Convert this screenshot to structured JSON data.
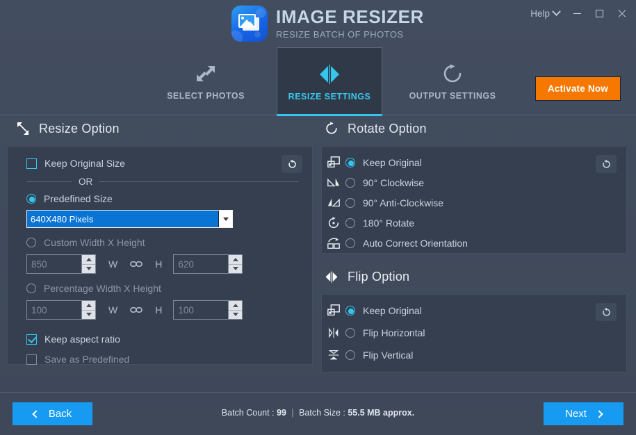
{
  "window": {
    "help_label": "Help",
    "minimize_icon": "minimize-icon",
    "maximize_icon": "maximize-icon",
    "close_icon": "close-icon"
  },
  "brand": {
    "title": "IMAGE RESIZER",
    "subtitle": "RESIZE BATCH OF PHOTOS",
    "logo_icon": "photos-stack-icon"
  },
  "tabs": [
    {
      "label": "SELECT PHOTOS",
      "icon": "expand-arrows-icon",
      "active": false
    },
    {
      "label": "RESIZE SETTINGS",
      "icon": "flip-horizontal-icon",
      "active": true
    },
    {
      "label": "OUTPUT SETTINGS",
      "icon": "rotate-clockwise-icon",
      "active": false
    }
  ],
  "activate": {
    "label": "Activate Now",
    "color": "#f67800"
  },
  "resize": {
    "heading": "Resize Option",
    "heading_icon": "resize-diagonal-icon",
    "reset_icon": "reset-icon",
    "keep_original_size": {
      "label": "Keep Original Size",
      "checked": false
    },
    "or_text": "OR",
    "predefined_size": {
      "label": "Predefined Size",
      "selected": true
    },
    "predefined_dropdown": {
      "value": "640X480 Pixels",
      "icon": "chevron-down-icon"
    },
    "custom_wh": {
      "label": "Custom Width X Height",
      "selected": false
    },
    "custom_width": "850",
    "custom_height": "620",
    "percentage_wh": {
      "label": "Percentage Width X Height",
      "selected": false
    },
    "percentage_width": "100",
    "percentage_height": "100",
    "w_label": "W",
    "h_label": "H",
    "link_icon": "chain-link-icon",
    "keep_aspect_ratio": {
      "label": "Keep aspect ratio",
      "checked": true
    },
    "save_as_predefined": {
      "label": "Save as Predefined",
      "checked": false,
      "disabled": true
    }
  },
  "rotate": {
    "heading": "Rotate Option",
    "heading_icon": "rotate-clockwise-icon",
    "reset_icon": "reset-icon",
    "options": [
      {
        "label": "Keep Original",
        "icon": "keep-original-icon",
        "selected": true
      },
      {
        "label": "90° Clockwise",
        "icon": "rotate-cw-90-icon",
        "selected": false
      },
      {
        "label": "90° Anti-Clockwise",
        "icon": "rotate-ccw-90-icon",
        "selected": false
      },
      {
        "label": "180° Rotate",
        "icon": "rotate-180-icon",
        "selected": false
      },
      {
        "label": "Auto Correct Orientation",
        "icon": "auto-orientation-icon",
        "selected": false
      }
    ]
  },
  "flip": {
    "heading": "Flip Option",
    "heading_icon": "flip-horizontal-icon",
    "reset_icon": "reset-icon",
    "options": [
      {
        "label": "Keep Original",
        "icon": "keep-original-icon",
        "selected": true
      },
      {
        "label": "Flip Horizontal",
        "icon": "flip-horizontal-icon",
        "selected": false
      },
      {
        "label": "Flip Vertical",
        "icon": "flip-vertical-icon",
        "selected": false
      }
    ]
  },
  "footer": {
    "back_label": "Back",
    "next_label": "Next",
    "batch_count_label": "Batch Count :",
    "batch_count_value": "99",
    "separator": "|",
    "batch_size_label": "Batch Size :",
    "batch_size_value": "55.5 MB approx."
  },
  "colors": {
    "accent": "#35c6ee",
    "primary_button": "#179af2",
    "activate": "#f67800",
    "background": "#3e4859",
    "panel": "#353f4f",
    "select_highlight": "#0a74d4"
  }
}
